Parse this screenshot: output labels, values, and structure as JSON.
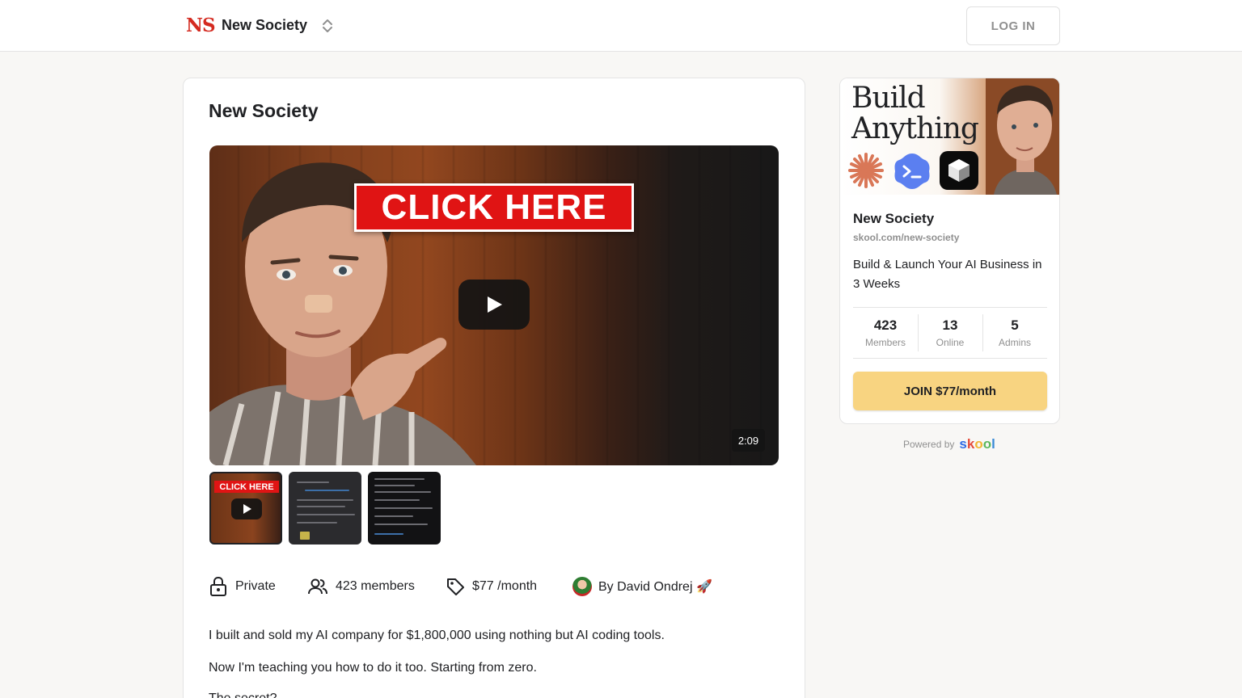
{
  "header": {
    "logo_text": "NS",
    "group_name": "New Society",
    "login_label": "LOG IN"
  },
  "main": {
    "title": "New Society",
    "video": {
      "overlay_text": "CLICK HERE",
      "duration": "2:09"
    },
    "thumbnails": [
      {
        "label": "CLICK HERE",
        "selected": true
      },
      {
        "label": "",
        "selected": false
      },
      {
        "label": "",
        "selected": false
      }
    ],
    "meta": {
      "privacy": "Private",
      "members": "423 members",
      "price": "$77 /month",
      "author": "By David Ondrej 🚀"
    },
    "description": [
      "I built and sold my AI company for $1,800,000 using nothing but AI coding tools.",
      "Now I'm teaching you how to do it too. Starting from zero.",
      "The secret?"
    ]
  },
  "sidebar": {
    "banner_text_line1": "Build",
    "banner_text_line2": "Anything",
    "name": "New Society",
    "url": "skool.com/new-society",
    "description": "Build & Launch Your AI Business in 3 Weeks",
    "stats": [
      {
        "value": "423",
        "label": "Members"
      },
      {
        "value": "13",
        "label": "Online"
      },
      {
        "value": "5",
        "label": "Admins"
      }
    ],
    "join_label": "JOIN $77/month",
    "powered_by": "Powered by",
    "brand": "skool"
  },
  "colors": {
    "logo_red": "#d42a20",
    "join_button": "#f8d481",
    "click_here_red": "#e01414",
    "skool_s": "#2e6be6",
    "skool_k": "#e44c3c",
    "skool_o1": "#f2b632",
    "skool_o2": "#5cb85c",
    "skool_l": "#3a8bd6"
  },
  "icons": [
    "chevron-up-down-icon",
    "play-icon",
    "lock-icon",
    "users-icon",
    "tag-icon",
    "rocket-emoji"
  ]
}
